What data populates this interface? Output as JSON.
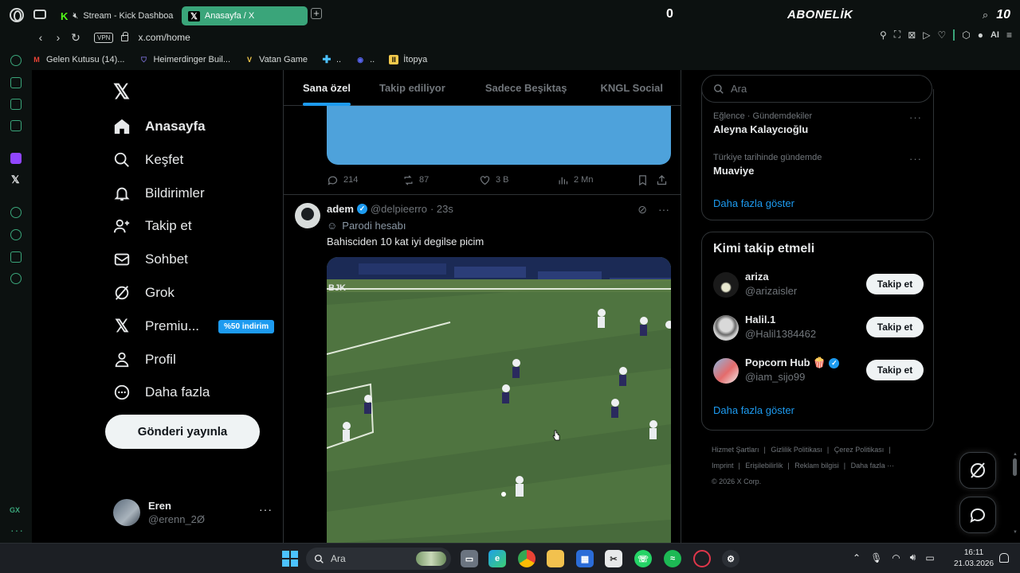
{
  "browser": {
    "tabs": [
      {
        "label": "Stream - Kick Dashboa"
      },
      {
        "label": "Anasayfa / X",
        "active": true
      }
    ],
    "score": "0",
    "subscription": "ABONELİK",
    "counter": "10",
    "vpn_label": "VPN",
    "url": "x.com/home",
    "ai_label": "AI",
    "bookmarks": [
      {
        "label": "Gelen Kutusu (14)...",
        "icon": "gmail-icon"
      },
      {
        "label": "Heimerdinger Buil...",
        "icon": "shield-icon"
      },
      {
        "label": "Vatan Game",
        "icon": "v-icon"
      },
      {
        "label": "..",
        "icon": "plus-icon"
      },
      {
        "label": "..",
        "icon": "discord-icon"
      },
      {
        "label": "İtopya",
        "icon": "itopya-icon"
      }
    ],
    "accent": "#3aa57a"
  },
  "nav": {
    "items": [
      {
        "label": "Anasayfa",
        "icon": "home-icon",
        "active": true
      },
      {
        "label": "Keşfet",
        "icon": "search-icon"
      },
      {
        "label": "Bildirimler",
        "icon": "bell-icon"
      },
      {
        "label": "Takip et",
        "icon": "add-person-icon"
      },
      {
        "label": "Sohbet",
        "icon": "mail-icon"
      },
      {
        "label": "Grok",
        "icon": "grok-icon"
      },
      {
        "label": "Premiu...",
        "icon": "x-icon",
        "badge": "%50 indirim"
      },
      {
        "label": "Profil",
        "icon": "person-icon"
      },
      {
        "label": "Daha fazla",
        "icon": "more-circle-icon"
      }
    ],
    "post_button": "Gönderi yayınla",
    "account": {
      "name": "Eren",
      "handle": "@erenn_2Ø"
    }
  },
  "timeline": {
    "tabs": [
      "Sana özel",
      "Takip ediliyor",
      "Sadece Beşiktaş",
      "KNGL Social"
    ],
    "prev_tweet": {
      "replies": "214",
      "reposts": "87",
      "likes": "3 B",
      "views": "2 Mn"
    },
    "tweet": {
      "name": "adem",
      "handle": "@delpieerro",
      "time": "· 23s",
      "parody": "Parodi hesabı",
      "text": "Bahisciden 10 kat iyi degilse picim",
      "video_watermark": "BJK"
    }
  },
  "right": {
    "search_placeholder": "Ara",
    "trends": [
      {
        "category": "Eğlence · Gündemdekiler",
        "name": "Aleyna Kalaycıoğlu"
      },
      {
        "category": "Türkiye tarihinde gündemde",
        "name": "Muaviye"
      }
    ],
    "show_more": "Daha fazla göster",
    "who_to_follow": {
      "title": "Kimi takip etmeli",
      "users": [
        {
          "name": "ariza",
          "handle": "@arizaisler",
          "button": "Takip et"
        },
        {
          "name": "Halil.1",
          "handle": "@Halil1384462",
          "button": "Takip et"
        },
        {
          "name": "Popcorn Hub 🍿",
          "handle": "@iam_sijo99",
          "button": "Takip et",
          "verified": true
        }
      ],
      "show_more": "Daha fazla göster"
    },
    "footer": {
      "links": [
        "Hizmet Şartları",
        "Gizlilik Politikası",
        "Çerez Politikası",
        "Imprint",
        "Erişilebilirlik",
        "Reklam bilgisi",
        "Daha fazla ···"
      ],
      "copyright": "© 2026 X Corp."
    }
  },
  "taskbar": {
    "search_label": "Ara",
    "time": "16:11",
    "date": "21.03.2026"
  }
}
